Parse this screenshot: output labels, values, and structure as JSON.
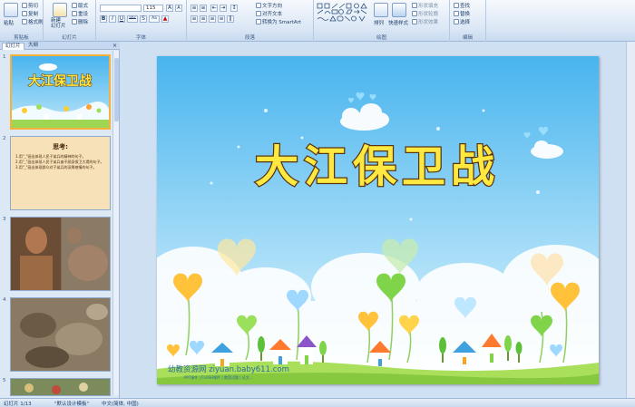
{
  "ribbon": {
    "clipboard": {
      "paste": "粘贴",
      "cut": "剪切",
      "copy": "复制",
      "format_painter": "格式刷",
      "label": "剪贴板"
    },
    "slides": {
      "new_slide": "新建\n幻灯片",
      "layout": "版式",
      "reset": "重设",
      "delete": "删除",
      "label": "幻灯片"
    },
    "font": {
      "size": "115",
      "label": "字体",
      "bold": "B",
      "italic": "I",
      "underline": "U",
      "strike": "abc",
      "shadow": "S",
      "grow": "A",
      "shrink": "A",
      "clear": "Aa"
    },
    "paragraph": {
      "text_direction": "文字方向",
      "align_text": "对齐文本",
      "smartart": "转换为 SmartArt",
      "label": "段落"
    },
    "drawing": {
      "arrange": "排列",
      "quick_styles": "快速样式",
      "shape_fill": "形状填充",
      "shape_outline": "形状轮廓",
      "shape_effects": "形状效果",
      "label": "绘图"
    },
    "editing": {
      "find": "查找",
      "replace": "替换",
      "select": "选择",
      "label": "编辑"
    }
  },
  "panel": {
    "tab_slides": "幻灯片",
    "tab_outline": "大纲",
    "close": "×",
    "thumbs": [
      {
        "num": "1",
        "title": "大江保卫战"
      },
      {
        "num": "2",
        "heading": "思考:",
        "lines": [
          "1.用\"_\"画出体现人民子弟兵的精神的句子。",
          "2.用\"_\"画出体现人民子弟兵奋不顾身保卫大堤的句子。",
          "3.用\"_\"画出体现群众对子弟兵的深厚感情的句子。"
        ]
      },
      {
        "num": "3"
      },
      {
        "num": "4"
      },
      {
        "num": "5"
      }
    ]
  },
  "slide": {
    "title": "大江保卫战",
    "watermark": "幼教资源网 ziyuan.baby611.com",
    "watermark_sub": "PPT课件 | FLASH课件 | 教案试题 | 论文..."
  },
  "status": {
    "slide_info": "幻灯片 1/13",
    "theme": "\"默认设计模板\"",
    "lang": "中文(简体, 中国)"
  }
}
